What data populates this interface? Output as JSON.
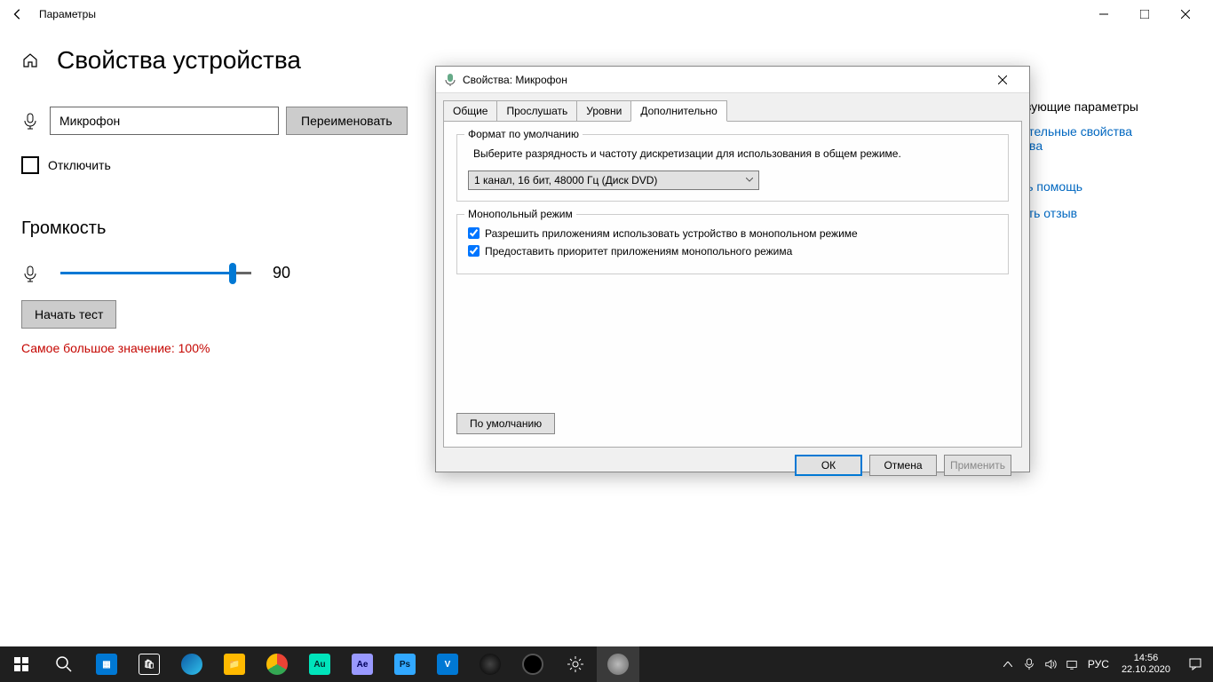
{
  "settings": {
    "window_title": "Параметры",
    "page_title": "Свойства устройства",
    "device_name": "Микрофон",
    "rename_btn": "Переименовать",
    "disable_label": "Отключить",
    "volume_heading": "Громкость",
    "volume_value": "90",
    "volume_percent": 90,
    "test_btn": "Начать тест",
    "test_result": "Самое большое значение: 100%",
    "related_heading": "Сопутствующие параметры",
    "link_additional": "Дополнительные свойства устройства",
    "help_link": "Получить помощь",
    "feedback_link": "Отправить отзыв"
  },
  "dialog": {
    "title": "Свойства: Микрофон",
    "tabs": [
      "Общие",
      "Прослушать",
      "Уровни",
      "Дополнительно"
    ],
    "active_tab": 3,
    "group_format_title": "Формат по умолчанию",
    "group_format_desc": "Выберите разрядность и частоту дискретизации для использования в общем режиме.",
    "format_value": "1 канал, 16 бит, 48000 Гц (Диск DVD)",
    "group_exclusive_title": "Монопольный режим",
    "check_allow_exclusive": "Разрешить приложениям использовать устройство в монопольном режиме",
    "check_priority": "Предоставить приоритет приложениям монопольного режима",
    "defaults_btn": "По умолчанию",
    "ok_btn": "ОК",
    "cancel_btn": "Отмена",
    "apply_btn": "Применить"
  },
  "taskbar": {
    "lang": "РУС",
    "time": "14:56",
    "date": "22.10.2020"
  }
}
